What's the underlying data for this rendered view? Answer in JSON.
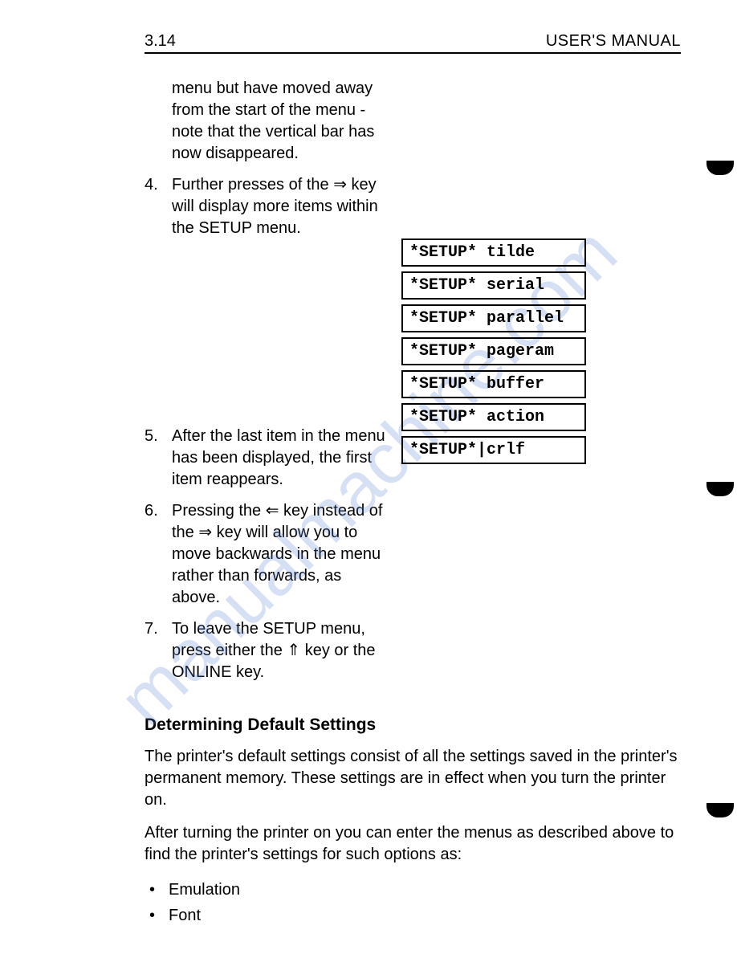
{
  "header": {
    "page_number": "3.14",
    "title": "USER'S MANUAL"
  },
  "watermark": "manualmachine.com",
  "steps": {
    "intro_fragment": "menu but have moved away from the start of the menu - note that the vertical bar has now disappeared.",
    "item4_num": "4.",
    "item4_text": "Further presses of the ⇒ key will display more items within the SETUP menu.",
    "item5_num": "5.",
    "item5_text": "After the last item in the menu has been displayed, the first item reappears.",
    "item6_num": "6.",
    "item6_text": "Pressing the ⇐ key instead of the ⇒ key will allow you to move backwards in the menu rather than forwards, as above.",
    "item7_num": "7.",
    "item7_text": "To leave the SETUP menu, press either the ⇑ key or the ONLINE key."
  },
  "setup_items": [
    "*SETUP* tilde",
    "*SETUP* serial",
    "*SETUP* parallel",
    "*SETUP* pageram",
    "*SETUP* buffer",
    "*SETUP* action",
    "*SETUP*|crlf"
  ],
  "section": {
    "heading": "Determining Default Settings",
    "para1": "The printer's default settings consist of all the settings saved in the printer's permanent memory. These settings are in effect when you turn the printer on.",
    "para2": "After turning the printer on you can enter the menus as described above to find the printer's settings for such options as:",
    "bullets": [
      "Emulation",
      "Font"
    ]
  }
}
